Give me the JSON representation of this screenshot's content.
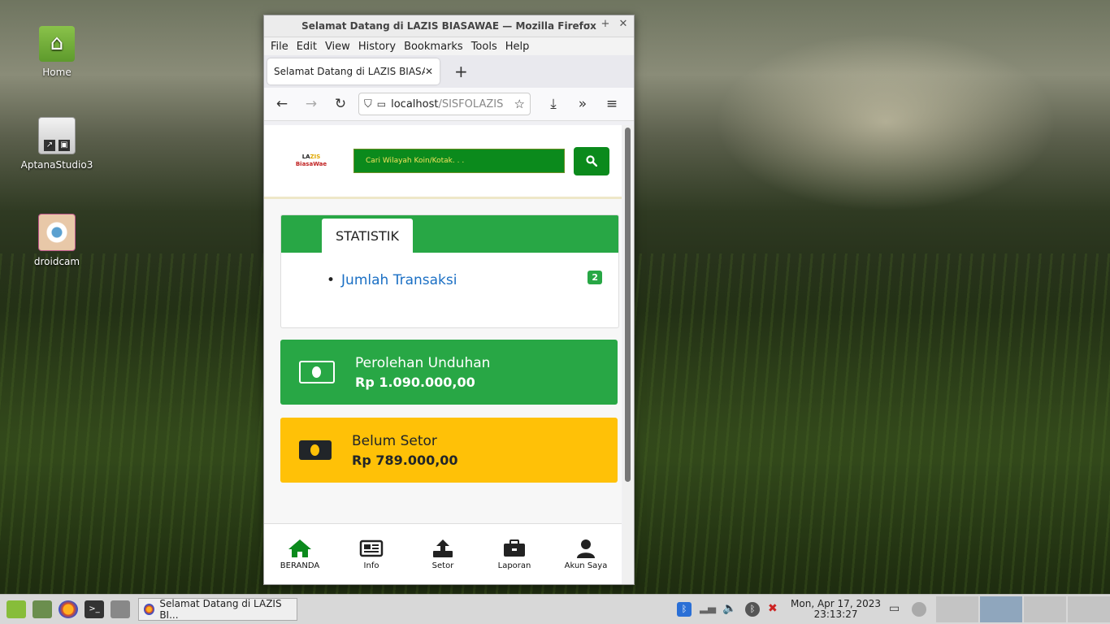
{
  "desktop": {
    "icons": [
      {
        "label": "Home"
      },
      {
        "label": "AptanaStudio3"
      },
      {
        "label": "droidcam"
      }
    ]
  },
  "window": {
    "title": "Selamat Datang di LAZIS BIASAWAE — Mozilla Firefox",
    "controls": [
      "–",
      "+",
      "✕"
    ]
  },
  "menu": [
    "File",
    "Edit",
    "View",
    "History",
    "Bookmarks",
    "Tools",
    "Help"
  ],
  "tab": {
    "title": "Selamat Datang di LAZIS BIASAWAE",
    "close": "✕",
    "new": "+"
  },
  "url": {
    "host": "localhost",
    "path": "/SISFOLAZIS"
  },
  "site": {
    "logo_line1_a": "LA",
    "logo_line1_b": "ZIS",
    "logo_line2": "BiasaWae",
    "search_placeholder": "Cari Wilayah Koin/Kotak. . .",
    "stat_tab": "STATISTIK",
    "stat_item": "Jumlah Transaksi",
    "stat_count": "2",
    "box1_title": "Perolehan Unduhan",
    "box1_value": "Rp 1.090.000,00",
    "box2_title": "Belum Setor",
    "box2_value": "Rp 789.000,00",
    "nav": [
      {
        "label": "BERANDA",
        "icon": "home-icon"
      },
      {
        "label": "Info",
        "icon": "newspaper-icon"
      },
      {
        "label": "Setor",
        "icon": "upload-icon"
      },
      {
        "label": "Laporan",
        "icon": "briefcase-icon"
      },
      {
        "label": "Akun Saya",
        "icon": "user-icon"
      }
    ]
  },
  "taskbar": {
    "task_label": "Selamat Datang di LAZIS BI...",
    "date": "Mon, Apr 17, 2023",
    "time": "23:13:27"
  },
  "colors": {
    "accent_green": "#28a745",
    "accent_yellow": "#ffc107",
    "dark_green": "#0b8a1c"
  }
}
